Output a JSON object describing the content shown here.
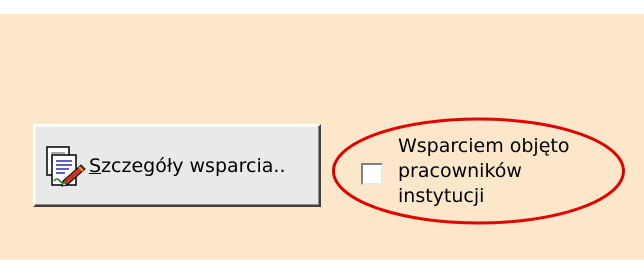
{
  "details_button": {
    "mnemonic": "S",
    "label_rest": "zczegóły wsparcia..",
    "icon": "document-edit-icon"
  },
  "support_checkbox": {
    "checked": false,
    "label_lines": [
      "Wsparciem objęto",
      "pracowników",
      "instytucji"
    ]
  },
  "colors": {
    "panel_background": "#fde7cb",
    "button_face": "#e9e9e9",
    "highlight": "#e00000"
  }
}
